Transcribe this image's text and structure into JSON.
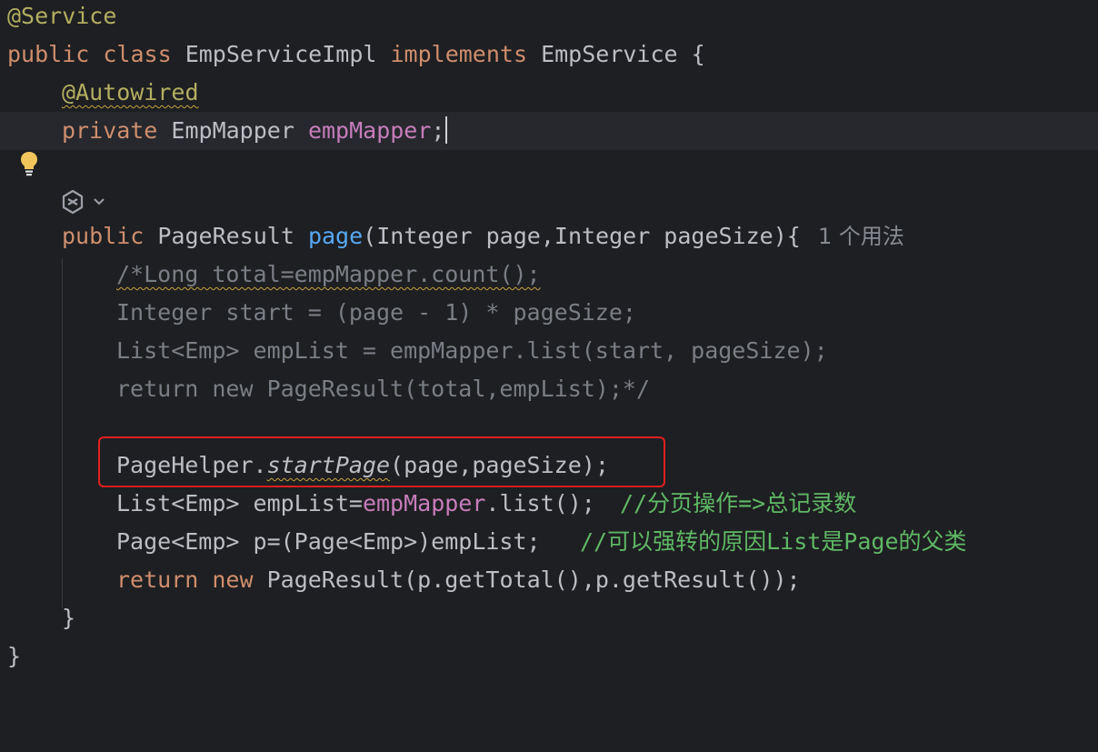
{
  "editor": {
    "line1": {
      "annotation": "@Service"
    },
    "line2": {
      "kw_public": "public",
      "kw_class": "class",
      "class_name": "EmpServiceImpl",
      "kw_implements": "implements",
      "interface_name": "EmpService",
      "brace": "{"
    },
    "line3": {
      "annotation": "@Autowired"
    },
    "line4": {
      "kw_private": "private",
      "type": "EmpMapper",
      "field": "empMapper",
      "semi": ";"
    },
    "line6": {
      "kw_public": "public",
      "return_type": "PageResult",
      "method": "page",
      "params": "(Integer page,Integer pageSize){",
      "usage_hint": "1 个用法"
    },
    "comment_lines": [
      "/*Long total=empMapper.count();",
      "Integer start = (page - 1) * pageSize;",
      "List<Emp> empList = empMapper.list(start, pageSize);",
      "return new PageResult(total,empList);*/"
    ],
    "line12": {
      "class": "PageHelper.",
      "method": "startPage",
      "args": "(page,pageSize);"
    },
    "line13": {
      "prefix": "List<Emp> empList=",
      "field": "empMapper",
      "suffix": ".list();",
      "comment": "//分页操作=>总记录数"
    },
    "line14": {
      "code": "Page<Emp> p=(Page<Emp>)empList;",
      "comment": "//可以强转的原因List是Page的父类"
    },
    "line15": {
      "kw_return": "return",
      "kw_new": "new",
      "rest": "PageResult(p.getTotal(),p.getResult());"
    },
    "line16": {
      "brace": "}"
    },
    "line17": {
      "brace": "}"
    }
  },
  "icons": {
    "bulb": "lightbulb-icon",
    "gutter": "ai-assistant-icon"
  },
  "colors": {
    "background": "#1e1f22",
    "keyword": "#cf8e6d",
    "annotation": "#b3ae60",
    "method": "#56a8f5",
    "field": "#c77dbb",
    "comment": "#7a7e85",
    "highlight_box": "#e02020"
  }
}
